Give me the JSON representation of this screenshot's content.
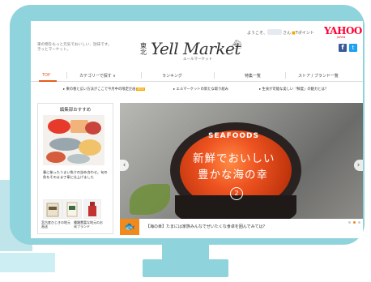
{
  "header": {
    "tagline": "東の物をもっと元気でおいしい、旨味です。きっとマーケット。",
    "logo_kanji": "東北",
    "logo_text": "Yell Market",
    "logo_sub": "エールマーケット",
    "welcome": "ようこそ、",
    "san": "さん",
    "points": "Tポイント",
    "yahoo_logo": "YAHOO!",
    "yahoo_sub": "JAPAN",
    "facebook_glyph": "f",
    "twitter_glyph": "t"
  },
  "nav": {
    "items": [
      "TOP",
      "カテゴリーで探す ∨",
      "ランキング",
      "特集一覧",
      "ストア / ブランド一覧"
    ]
  },
  "news": {
    "items": [
      "東の春と広い方法がここで今月中の限定企画",
      "NEW",
      "エルマーケットの新たな取り組み",
      "生食が可能な美しい「鮮度」の魅力とは？"
    ]
  },
  "sidebar": {
    "title": "編集部おすすめ",
    "caption_main": "春に揃ったうまい魚介の詰め合わせ。旬の魚をそのまま丁寧に仕上げました",
    "thumb_captions": [
      "宮古産ひじきの地元直送",
      "種類豊富な地元のお米ブランド"
    ]
  },
  "slider": {
    "kicker": "SEAFOODS",
    "headline_1": "新鮮でおいしい",
    "headline_2": "豊かな海の幸",
    "slide_number": "2",
    "prev_arrow": "‹",
    "next_arrow": "›"
  },
  "caption": {
    "icon": "🐟",
    "text": "【海の幸】たまには家族みんなでぜいたくな食卓を囲んでみては？"
  },
  "colors": {
    "monitor_frame": "#8fd3dc",
    "accent": "#e85a1e",
    "caption_icon": "#f08a1c",
    "yahoo": "#ff0033"
  }
}
